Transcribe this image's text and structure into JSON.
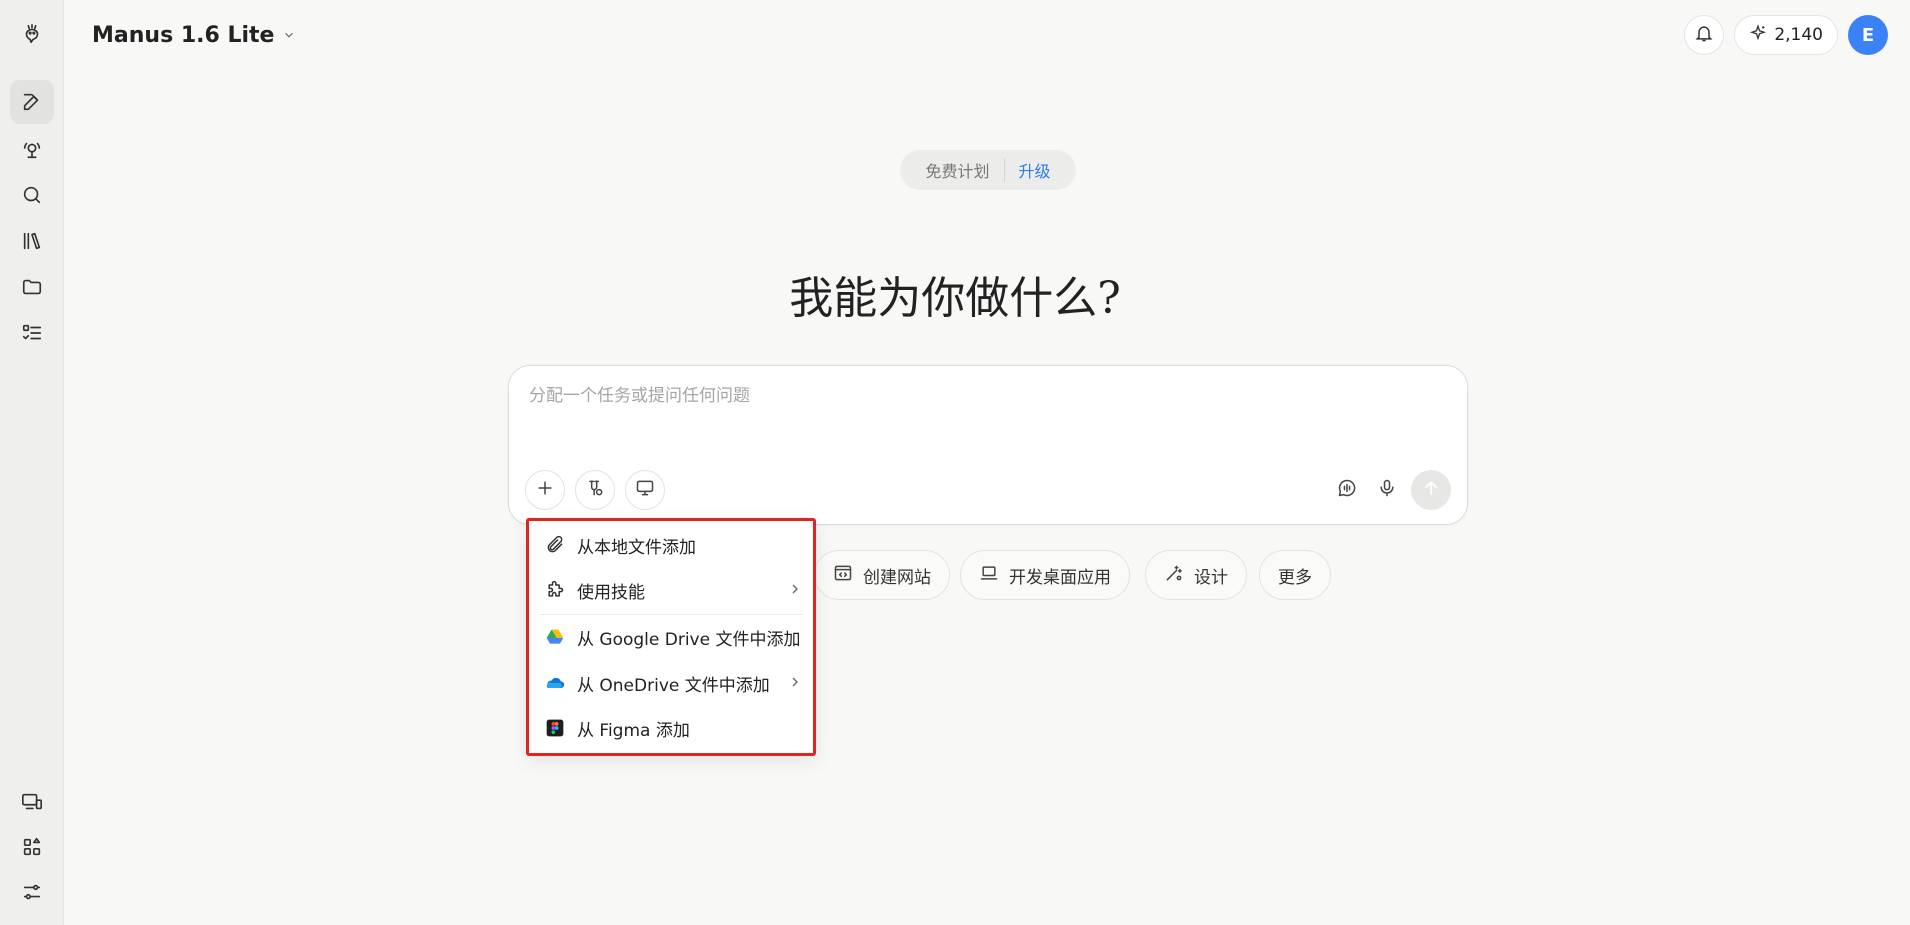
{
  "app": {
    "model_title": "Manus 1.6 Lite",
    "credits": "2,140",
    "avatar_letter": "E",
    "accent_color": "#3b82f6",
    "highlight_color": "#e32222"
  },
  "sidebar": {
    "items": [
      {
        "icon": "logo-icon"
      },
      {
        "icon": "new-task-icon"
      },
      {
        "icon": "agents-icon"
      },
      {
        "icon": "search-icon"
      },
      {
        "icon": "library-icon"
      },
      {
        "icon": "folder-icon"
      },
      {
        "icon": "tasks-checklist-icon"
      },
      {
        "icon": "devices-icon"
      },
      {
        "icon": "apps-grid-icon"
      },
      {
        "icon": "settings-sliders-icon"
      }
    ]
  },
  "plan": {
    "free_label": "免费计划",
    "upgrade_label": "升级"
  },
  "hero": {
    "title": "我能为你做什么?"
  },
  "composer": {
    "placeholder": "分配一个任务或提问任何问题"
  },
  "chips": [
    {
      "label": "创建网站",
      "icon": "code-window-icon"
    },
    {
      "label": "开发桌面应用",
      "icon": "laptop-icon"
    },
    {
      "label": "设计",
      "icon": "design-wand-icon"
    },
    {
      "label": "更多",
      "icon": ""
    }
  ],
  "menu": {
    "items": [
      {
        "label": "从本地文件添加",
        "icon": "paperclip-icon",
        "submenu": false
      },
      {
        "label": "使用技能",
        "icon": "puzzle-icon",
        "submenu": true
      },
      {
        "label": "从 Google Drive 文件中添加",
        "icon": "google-drive-icon",
        "submenu": false
      },
      {
        "label": "从 OneDrive 文件中添加",
        "icon": "onedrive-icon",
        "submenu": true
      },
      {
        "label": "从 Figma 添加",
        "icon": "figma-icon",
        "submenu": false
      }
    ]
  }
}
